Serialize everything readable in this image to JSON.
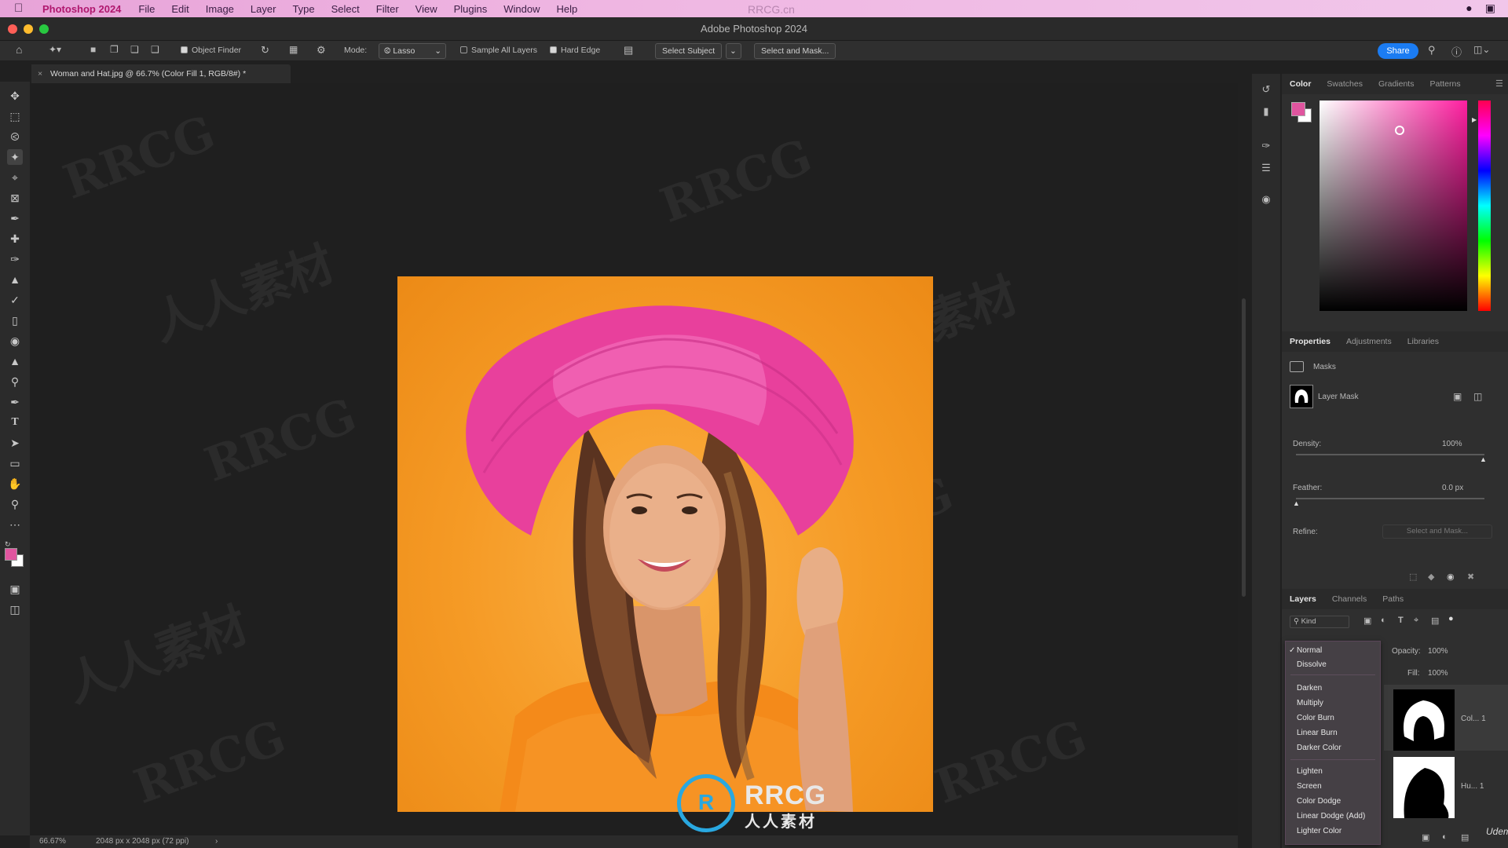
{
  "menubar": {
    "app_name": "Photoshop 2024",
    "items": [
      "File",
      "Edit",
      "Image",
      "Layer",
      "Type",
      "Select",
      "Filter",
      "View",
      "Plugins",
      "Window",
      "Help"
    ]
  },
  "window": {
    "title": "Adobe Photoshop 2024"
  },
  "options_bar": {
    "object_finder": "Object Finder",
    "mode_label": "Mode:",
    "mode_value": "Lasso",
    "sample_all_layers": "Sample All Layers",
    "hard_edge": "Hard Edge",
    "select_subject": "Select Subject",
    "select_and_mask": "Select and Mask...",
    "share": "Share"
  },
  "document": {
    "tab_title": "Woman and Hat.jpg @ 66.7% (Color Fill 1, RGB/8#) *",
    "zoom": "66.67%",
    "doc_info": "2048 px x 2048 px (72 ppi)"
  },
  "color_panel": {
    "tabs": [
      "Color",
      "Swatches",
      "Gradients",
      "Patterns"
    ],
    "foreground": "#e0559f",
    "background": "#ffffff"
  },
  "properties_panel": {
    "tabs": [
      "Properties",
      "Adjustments",
      "Libraries"
    ],
    "section": "Masks",
    "layer_mask_label": "Layer Mask",
    "density_label": "Density:",
    "density_value": "100%",
    "feather_label": "Feather:",
    "feather_value": "0.0 px",
    "refine_label": "Refine:",
    "refine_button": "Select and Mask..."
  },
  "layers_panel": {
    "tabs": [
      "Layers",
      "Channels",
      "Paths"
    ],
    "filter": "Kind",
    "opacity_label": "Opacity:",
    "opacity_value": "100%",
    "fill_label": "Fill:",
    "fill_value": "100%",
    "layers": [
      {
        "name": "Col... 1"
      },
      {
        "name": "Hu... 1"
      }
    ]
  },
  "blend_menu": {
    "groups": [
      [
        "Normal",
        "Dissolve"
      ],
      [
        "Darken",
        "Multiply",
        "Color Burn",
        "Linear Burn",
        "Darker Color"
      ],
      [
        "Lighten",
        "Screen",
        "Color Dodge",
        "Linear Dodge (Add)",
        "Lighter Color"
      ]
    ],
    "selected": "Normal"
  },
  "watermark": {
    "brand": "RRCG",
    "cn": "人人素材",
    "site": "RRCG.cn",
    "udemy": "Udemy"
  }
}
